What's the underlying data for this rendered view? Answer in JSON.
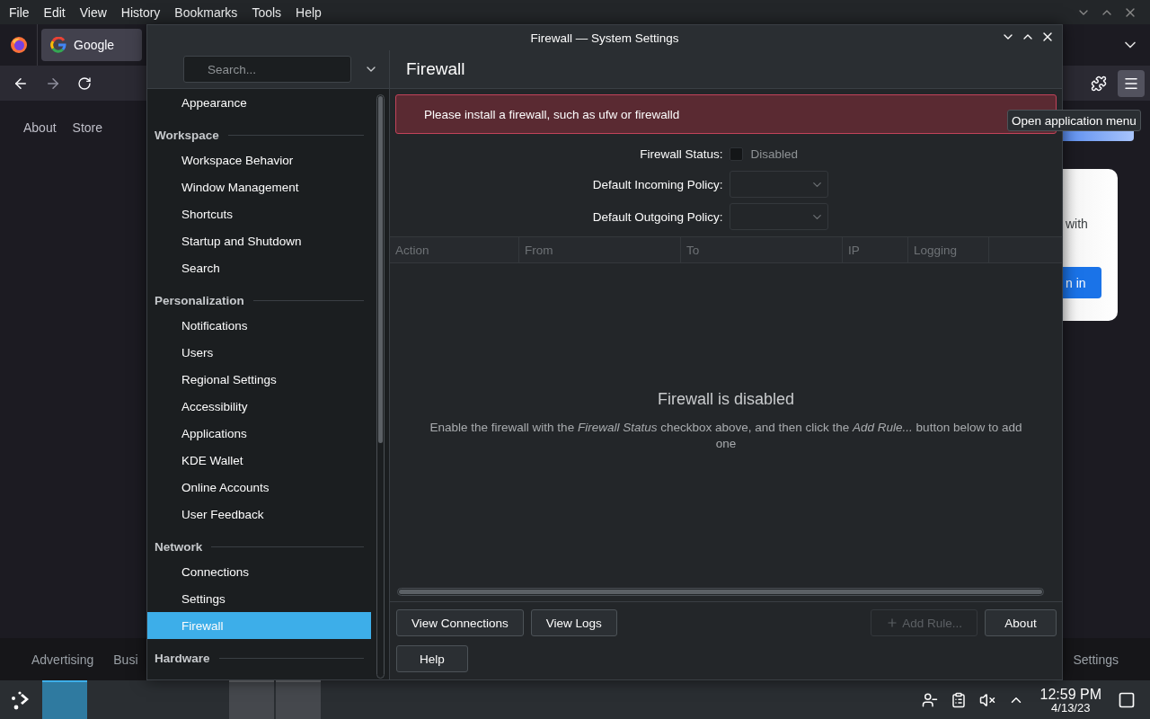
{
  "browser": {
    "menu": [
      "File",
      "Edit",
      "View",
      "History",
      "Bookmarks",
      "Tools",
      "Help"
    ],
    "tab": {
      "title": "Google"
    },
    "page": {
      "nav": [
        "About",
        "Store"
      ],
      "card_text": "with",
      "card_button": "n in",
      "footer_left": [
        "Advertising",
        "Busi"
      ],
      "footer_right": [
        "Settings"
      ]
    },
    "tooltip": "Open application menu"
  },
  "dialog": {
    "title": "Firewall — System Settings",
    "search": {
      "placeholder": "Search..."
    },
    "sidebar": [
      {
        "items": [
          {
            "label": "Appearance",
            "selected": false
          }
        ]
      },
      {
        "title": "Workspace",
        "items": [
          {
            "label": "Workspace Behavior",
            "selected": false
          },
          {
            "label": "Window Management",
            "selected": false
          },
          {
            "label": "Shortcuts",
            "selected": false
          },
          {
            "label": "Startup and Shutdown",
            "selected": false
          },
          {
            "label": "Search",
            "selected": false
          }
        ]
      },
      {
        "title": "Personalization",
        "items": [
          {
            "label": "Notifications",
            "selected": false
          },
          {
            "label": "Users",
            "selected": false
          },
          {
            "label": "Regional Settings",
            "selected": false
          },
          {
            "label": "Accessibility",
            "selected": false
          },
          {
            "label": "Applications",
            "selected": false
          },
          {
            "label": "KDE Wallet",
            "selected": false
          },
          {
            "label": "Online Accounts",
            "selected": false
          },
          {
            "label": "User Feedback",
            "selected": false
          }
        ]
      },
      {
        "title": "Network",
        "items": [
          {
            "label": "Connections",
            "selected": false
          },
          {
            "label": "Settings",
            "selected": false
          },
          {
            "label": "Firewall",
            "selected": true
          }
        ]
      },
      {
        "title": "Hardware"
      }
    ],
    "page_title": "Firewall",
    "error": "Please install a firewall, such as ufw or firewalld",
    "status": {
      "label": "Firewall Status:",
      "checked": false,
      "text": "Disabled"
    },
    "policies": [
      {
        "label": "Default Incoming Policy:"
      },
      {
        "label": "Default Outgoing Policy:"
      }
    ],
    "table": {
      "columns": [
        "Action",
        "From",
        "To",
        "IP",
        "Logging"
      ]
    },
    "empty": {
      "title": "Firewall is disabled",
      "text": "Enable the firewall with the *Firewall Status* checkbox above, and then click the *Add Rule...* button below to add one"
    },
    "buttons_left": [
      {
        "label": "View Connections",
        "disabled": false
      },
      {
        "label": "View Logs",
        "disabled": false
      }
    ],
    "buttons_right": [
      {
        "label": "Add Rule...",
        "disabled": true,
        "kind": "add"
      },
      {
        "label": "About",
        "disabled": false,
        "kind": "plain"
      }
    ],
    "help": {
      "label": "Help",
      "disabled": false
    }
  },
  "taskbar": {
    "tasks": [
      {
        "selected": true
      },
      {
        "selected": false
      },
      {
        "selected": false
      }
    ],
    "clock": {
      "time": "12:59 PM",
      "date": "4/13/23"
    }
  }
}
